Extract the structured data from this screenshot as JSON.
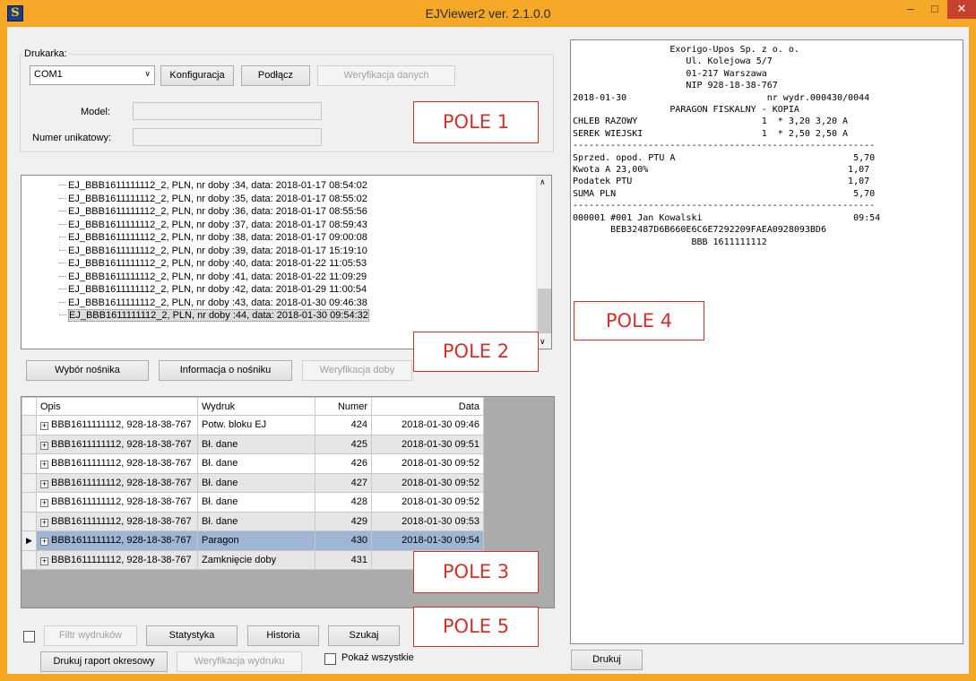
{
  "window": {
    "title": "EJViewer2 ver. 2.1.0.0",
    "min_glyph": "–",
    "max_glyph": "□",
    "close_glyph": "✕",
    "app_icon_glyph": "S"
  },
  "printer_group": {
    "label": "Drukarka:",
    "port_value": "COM1",
    "configure_label": "Konfiguracja",
    "connect_label": "Podłącz",
    "verify_data_label": "Weryfikacja danych",
    "model_label": "Model:",
    "serial_label": "Numer unikatowy:",
    "model_value": "",
    "serial_value": ""
  },
  "callouts": {
    "pole1": "POLE 1",
    "pole2": "POLE 2",
    "pole3": "POLE 3",
    "pole4": "POLE 4",
    "pole5": "POLE 5"
  },
  "tree_items": [
    "EJ_BBB1611111112_2, PLN, nr doby :34, data: 2018-01-17 08:54:02",
    "EJ_BBB1611111112_2, PLN, nr doby :35, data: 2018-01-17 08:55:02",
    "EJ_BBB1611111112_2, PLN, nr doby :36, data: 2018-01-17 08:55:56",
    "EJ_BBB1611111112_2, PLN, nr doby :37, data: 2018-01-17 08:59:43",
    "EJ_BBB1611111112_2, PLN, nr doby :38, data: 2018-01-17 09:00:08",
    "EJ_BBB1611111112_2, PLN, nr doby :39, data: 2018-01-17 15:19:10",
    "EJ_BBB1611111112_2, PLN, nr doby :40, data: 2018-01-22 11:05:53",
    "EJ_BBB1611111112_2, PLN, nr doby :41, data: 2018-01-22 11:09:29",
    "EJ_BBB1611111112_2, PLN, nr doby :42, data: 2018-01-29 11:00:54",
    "EJ_BBB1611111112_2, PLN, nr doby :43, data: 2018-01-30 09:46:38",
    "EJ_BBB1611111112_2, PLN, nr doby :44, data: 2018-01-30 09:54:32"
  ],
  "media_buttons": {
    "select_media": "Wybór nośnika",
    "media_info": "Informacja o nośniku",
    "verify_day": "Weryfikacja doby"
  },
  "grid": {
    "columns": [
      "Opis",
      "Wydruk",
      "Numer",
      "Data"
    ],
    "rows": [
      {
        "opis": "BBB1611111112, 928-18-38-767",
        "wydruk": "Potw. bloku EJ",
        "numer": "424",
        "data": "2018-01-30 09:46"
      },
      {
        "opis": "BBB1611111112, 928-18-38-767",
        "wydruk": "Bł. dane",
        "numer": "425",
        "data": "2018-01-30 09:51"
      },
      {
        "opis": "BBB1611111112, 928-18-38-767",
        "wydruk": "Bł. dane",
        "numer": "426",
        "data": "2018-01-30 09:52"
      },
      {
        "opis": "BBB1611111112, 928-18-38-767",
        "wydruk": "Bł. dane",
        "numer": "427",
        "data": "2018-01-30 09:52"
      },
      {
        "opis": "BBB1611111112, 928-18-38-767",
        "wydruk": "Bł. dane",
        "numer": "428",
        "data": "2018-01-30 09:52"
      },
      {
        "opis": "BBB1611111112, 928-18-38-767",
        "wydruk": "Bł. dane",
        "numer": "429",
        "data": "2018-01-30 09:53"
      },
      {
        "opis": "BBB1611111112, 928-18-38-767",
        "wydruk": "Paragon",
        "numer": "430",
        "data": "2018-01-30 09:54"
      },
      {
        "opis": "BBB1611111112, 928-18-38-767",
        "wydruk": "Zamknięcie doby",
        "numer": "431",
        "data": ""
      }
    ],
    "selected_index": 6
  },
  "bottom": {
    "filter_label": "Filtr wydruków",
    "stats_label": "Statystyka",
    "history_label": "Historia",
    "search_label": "Szukaj",
    "period_report_label": "Drukuj raport okresowy",
    "verify_print_label": "Weryfikacja wydruku",
    "show_all_label": "Pokaż wszystkie",
    "print_label": "Drukuj"
  },
  "receipt_lines": [
    "                  Exorigo-Upos Sp. z o. o.",
    "                     Ul. Kolejowa 5/7",
    "                     01-217 Warszawa",
    "                     NIP 928-18-38-767",
    "2018-01-30                          nr wydr.000430/0044",
    "                  PARAGON FISKALNY - KOPIA",
    "CHLEB RAZOWY                       1  * 3,20 3,20 A",
    "SEREK WIEJSKI                      1  * 2,50 2,50 A",
    "--------------------------------------------------------",
    "Sprzed. opod. PTU A                                 5,70",
    "Kwota A 23,00%                                     1,07",
    "Podatek PTU                                        1,07",
    "SUMA PLN                                            5,70",
    "--------------------------------------------------------",
    "000001 #001 Jan Kowalski                            09:54",
    "       BEB32487D6B660E6C6E7292209FAEA0928093BD6",
    "                      BBB 1611111112"
  ]
}
